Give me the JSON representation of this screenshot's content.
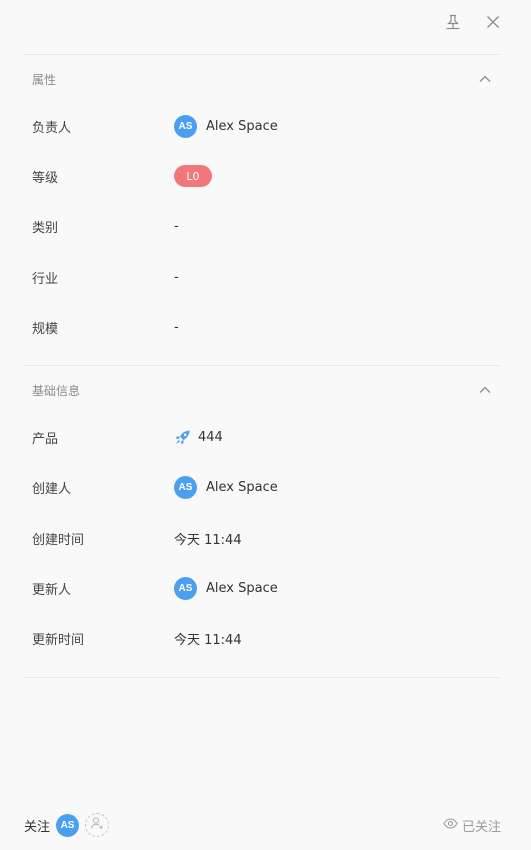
{
  "sections": {
    "properties": {
      "title": "属性",
      "rows": {
        "owner": {
          "label": "负责人",
          "avatar": "AS",
          "value": "Alex Space"
        },
        "level": {
          "label": "等级",
          "value": "L0"
        },
        "category": {
          "label": "类别",
          "value": "-"
        },
        "industry": {
          "label": "行业",
          "value": "-"
        },
        "scale": {
          "label": "规模",
          "value": "-"
        }
      }
    },
    "basic_info": {
      "title": "基础信息",
      "rows": {
        "product": {
          "label": "产品",
          "icon": "rocket-icon",
          "value": "444"
        },
        "creator": {
          "label": "创建人",
          "avatar": "AS",
          "value": "Alex Space"
        },
        "created_time": {
          "label": "创建时间",
          "value": "今天 11:44"
        },
        "updater": {
          "label": "更新人",
          "avatar": "AS",
          "value": "Alex Space"
        },
        "updated_time": {
          "label": "更新时间",
          "value": "今天 11:44"
        }
      }
    }
  },
  "footer": {
    "follow_label": "关注",
    "follower_avatar": "AS",
    "followed_label": "已关注"
  },
  "icons": {
    "pin": "pin-icon",
    "close": "close-icon",
    "collapse": "chevron-up-icon",
    "add_follower": "add-user-icon",
    "followed": "eye-icon"
  },
  "colors": {
    "accent": "#4b9ff0",
    "level_badge": "#f2777a",
    "background": "#f9f9fa"
  }
}
